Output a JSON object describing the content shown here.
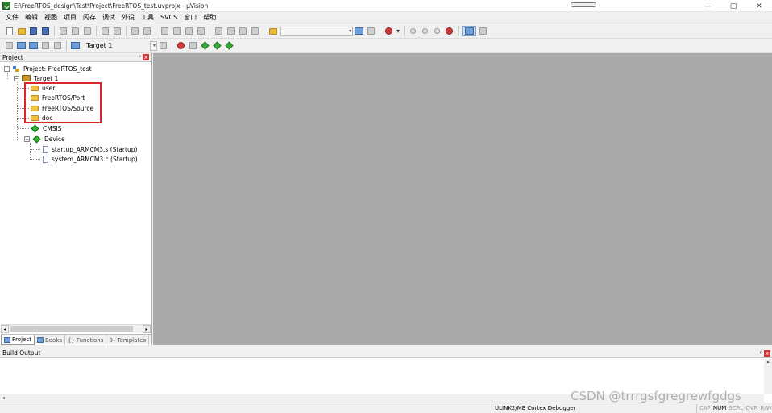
{
  "window": {
    "title": "E:\\FreeRTOS_design\\Test\\Project\\FreeRTOS_test.uvprojx - µVision",
    "minimize": "—",
    "restore": "▢",
    "close": "✕"
  },
  "menu": [
    "文件",
    "编辑",
    "视图",
    "项目",
    "闪存",
    "调试",
    "外设",
    "工具",
    "SVCS",
    "窗口",
    "帮助"
  ],
  "toolbar2": {
    "target": "Target 1"
  },
  "project_panel": {
    "title": "Project",
    "pin": "ᵖ",
    "close": "x",
    "tree": {
      "root": "Project: FreeRTOS_test",
      "target": "Target 1",
      "groups": [
        "user",
        "FreeRTOS/Port",
        "FreeRTOS/Source",
        "doc"
      ],
      "cmsis": "CMSIS",
      "device": "Device",
      "device_files": [
        "startup_ARMCM3.s (Startup)",
        "system_ARMCM3.c (Startup)"
      ]
    },
    "tabs": [
      {
        "label": "Project",
        "active": true
      },
      {
        "label": "Books",
        "active": false
      },
      {
        "label": "Functions",
        "active": false
      },
      {
        "label": "Templates",
        "active": false
      }
    ]
  },
  "build_output": {
    "title": "Build Output",
    "pin": "ᵖ",
    "close": "x"
  },
  "statusbar": {
    "debugger": "ULINK2/ME Cortex Debugger",
    "indicators": [
      {
        "label": "CAP",
        "on": false
      },
      {
        "label": "NUM",
        "on": true
      },
      {
        "label": "SCRL",
        "on": false
      },
      {
        "label": "OVR",
        "on": false
      },
      {
        "label": "R/W",
        "on": false
      }
    ]
  },
  "watermark": "CSDN @trrrgsfgregrewfgdgs"
}
